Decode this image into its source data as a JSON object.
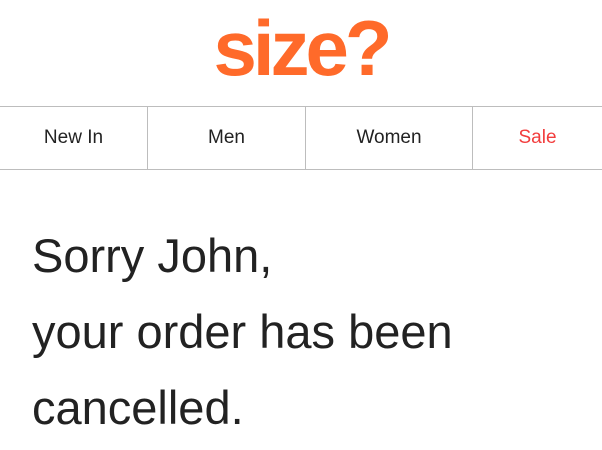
{
  "brand": {
    "logo_text": "size?",
    "logo_color": "#ff6a2a"
  },
  "nav": {
    "items": [
      {
        "label": "New In",
        "color": "#222222"
      },
      {
        "label": "Men",
        "color": "#222222"
      },
      {
        "label": "Women",
        "color": "#222222"
      },
      {
        "label": "Sale",
        "color": "#f23d3d"
      }
    ]
  },
  "message": {
    "line1": "Sorry John,",
    "line2": "your order has been",
    "line3": "cancelled."
  }
}
